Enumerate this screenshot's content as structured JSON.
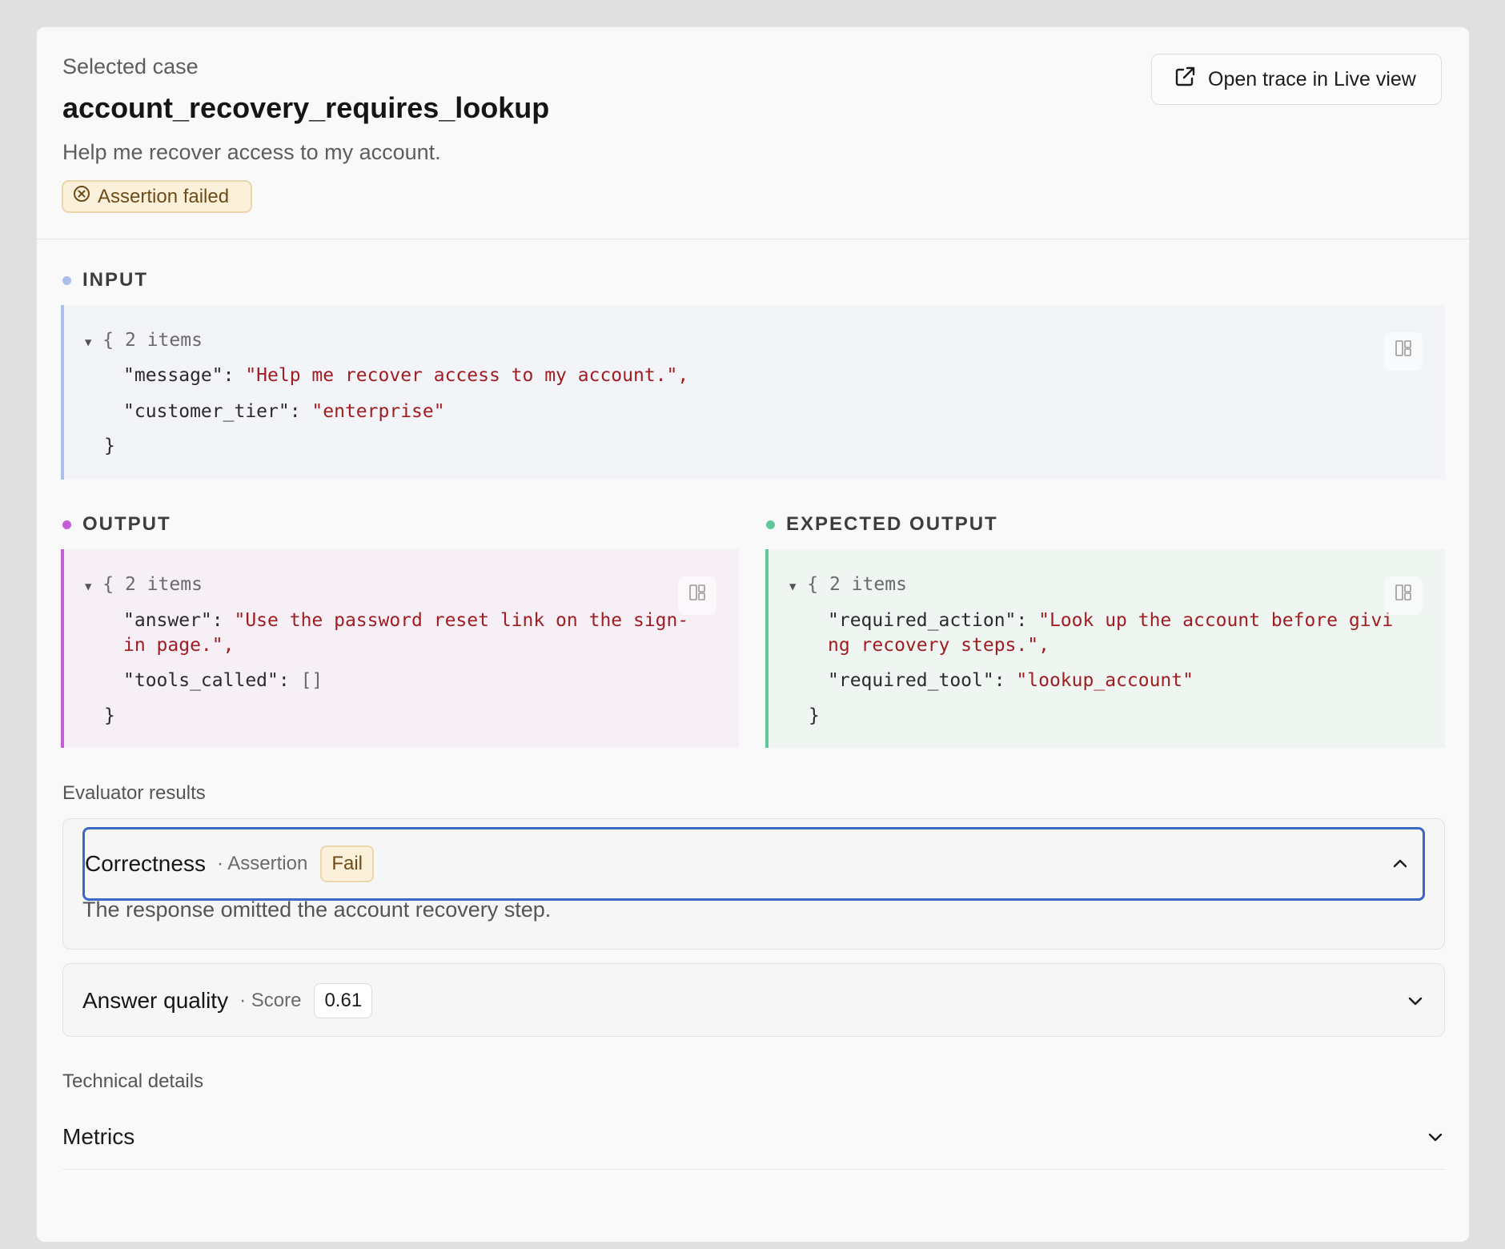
{
  "header": {
    "eyebrow": "Selected case",
    "case_name": "account_recovery_requires_lookup",
    "case_description": "Help me recover access to my account.",
    "status_badge": "Assertion failed",
    "open_trace_label": "Open trace in Live view"
  },
  "input": {
    "label": "INPUT",
    "summary": "{ 2 items",
    "lines": [
      {
        "key": "\"message\"",
        "value": "\"Help me recover access to my account.\","
      },
      {
        "key": "\"customer_tier\"",
        "value": "\"enterprise\""
      }
    ],
    "close": "}"
  },
  "output": {
    "label": "OUTPUT",
    "summary": "{ 2 items",
    "answer_key": "\"answer\"",
    "answer_value_1": "\"Use the password reset link on the sign-",
    "answer_value_2": "in page.\",",
    "tools_key": "\"tools_called\"",
    "tools_value": "[]",
    "close": "}"
  },
  "expected_output": {
    "label": "EXPECTED OUTPUT",
    "summary": "{ 2 items",
    "action_key": "\"required_action\"",
    "action_value_1": "\"Look up the account before givi",
    "action_value_2": "ng recovery steps.\",",
    "tool_key": "\"required_tool\"",
    "tool_value": "\"lookup_account\"",
    "close": "}"
  },
  "evaluator_results": {
    "label": "Evaluator results",
    "items": [
      {
        "name": "Correctness",
        "kind": "· Assertion",
        "result": "Fail",
        "detail": "The response omitted the account recovery step.",
        "expanded": true
      },
      {
        "name": "Answer quality",
        "kind": "· Score",
        "result": "0.61",
        "expanded": false
      }
    ]
  },
  "technical_details": {
    "label": "Technical details",
    "metrics_label": "Metrics"
  },
  "colors": {
    "input_accent": "#a9c0e8",
    "output_accent": "#c45ed6",
    "expected_accent": "#5fc89a",
    "fail_bg": "#fbf0da",
    "focus_ring": "#3a68c4"
  },
  "icons": {
    "open_trace": "external-link-icon",
    "status": "circle-x-icon",
    "copy": "copy-icon",
    "expand": "chevron-up-icon",
    "collapse": "chevron-down-icon",
    "toggle": "caret-down-icon"
  }
}
